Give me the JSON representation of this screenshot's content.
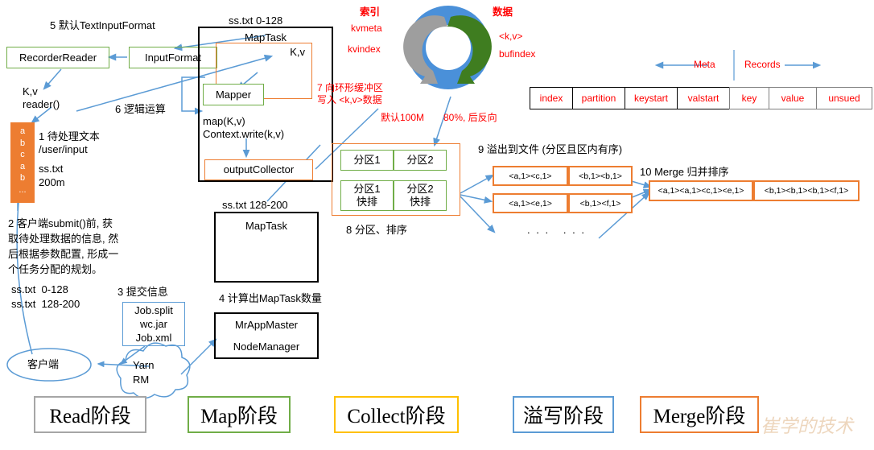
{
  "diagram": {
    "title": "MapReduce MapTask flow",
    "colors": {
      "green": "#70ad47",
      "orange": "#ed7d31",
      "blue": "#5b9bd5",
      "black": "#000000",
      "gray": "#a6a6a6",
      "yellow": "#ffc000",
      "red": "#ff0000",
      "ring_fill": "#4a90d9",
      "ring_arrow_green": "#3f7d20",
      "ring_arrow_gray": "#9e9e9e"
    }
  },
  "read_stage": {
    "step5_label": "5 默认TextInputFormat",
    "recorder_reader": "RecorderReader",
    "input_format": "InputFormat",
    "kv_reader": "K,v\nreader()",
    "step1_label": "1 待处理文本\n/user/input",
    "file_name": "ss.txt",
    "file_size": "200m",
    "orange_bar_chars": "a\nb\nc\na\nb\n...",
    "step2_label": "2 客户端submit()前, 获\n取待处理数据的信息, 然\n后根据参数配置, 形成一\n个任务分配的规划。",
    "split_0_128": "ss.txt  0-128",
    "split_128_200": "ss.txt  128-200",
    "step3_label": "3 提交信息",
    "job_files": "Job.split\nwc.jar\nJob.xml",
    "client": "客户端",
    "yarn_rm": "Yarn\nRM",
    "step4_label": "4 计算出MapTask数量",
    "app_master": "MrAppMaster",
    "node_manager": "NodeManager"
  },
  "map_stage": {
    "maptask_1_caption": "ss.txt 0-128",
    "maptask_1_title": "MapTask",
    "kv": "K,v",
    "mapper": "Mapper",
    "step6_label": "6 逻辑运算",
    "map_call": "map(K,v)\nContext.write(k,v)",
    "output_collector": "outputCollector",
    "maptask_2_caption": "ss.txt 128-200",
    "maptask_2_title": "MapTask"
  },
  "collect_stage": {
    "index_title": "索引",
    "kvmeta": "kvmeta",
    "kvindex": "kvindex",
    "data_title": "数据",
    "kv_pair": "<k,v>",
    "bufindex": "bufindex",
    "step7_label": "7 向环形缓冲区\n写入 <k,v>数据",
    "default_size": "默认100M",
    "threshold": "80%, 后反向",
    "meta_arrow_label": "Meta",
    "records_arrow_label": "Records",
    "buffer_table": [
      "index",
      "partition",
      "keystart",
      "valstart",
      "key",
      "value",
      "unsued"
    ]
  },
  "spill_stage": {
    "partition_top": [
      "分区1",
      "分区2"
    ],
    "partition_bottom": [
      "分区1\n快排",
      "分区2\n快排"
    ],
    "step8_label": "8 分区、排序",
    "step9_label": "9 溢出到文件 (分区且区内有序)",
    "spill_files": [
      [
        "<a,1><c,1>",
        "<b,1><b,1>"
      ],
      [
        "<a,1><e,1>",
        "<b,1><f,1>"
      ]
    ],
    "ellipsis": ". . .   . . ."
  },
  "merge_stage": {
    "step10_label": "10 Merge 归并排序",
    "merged": [
      "<a,1><a,1><c,1><e,1>",
      "<b,1><b,1><b,1><f,1>"
    ]
  },
  "legend": [
    {
      "label": "Read阶段",
      "color": "#a6a6a6"
    },
    {
      "label": "Map阶段",
      "color": "#70ad47"
    },
    {
      "label": "Collect阶段",
      "color": "#ffc000"
    },
    {
      "label": "溢写阶段",
      "color": "#5b9bd5"
    },
    {
      "label": "Merge阶段",
      "color": "#ed7d31"
    }
  ],
  "watermark": "崔学的技术"
}
